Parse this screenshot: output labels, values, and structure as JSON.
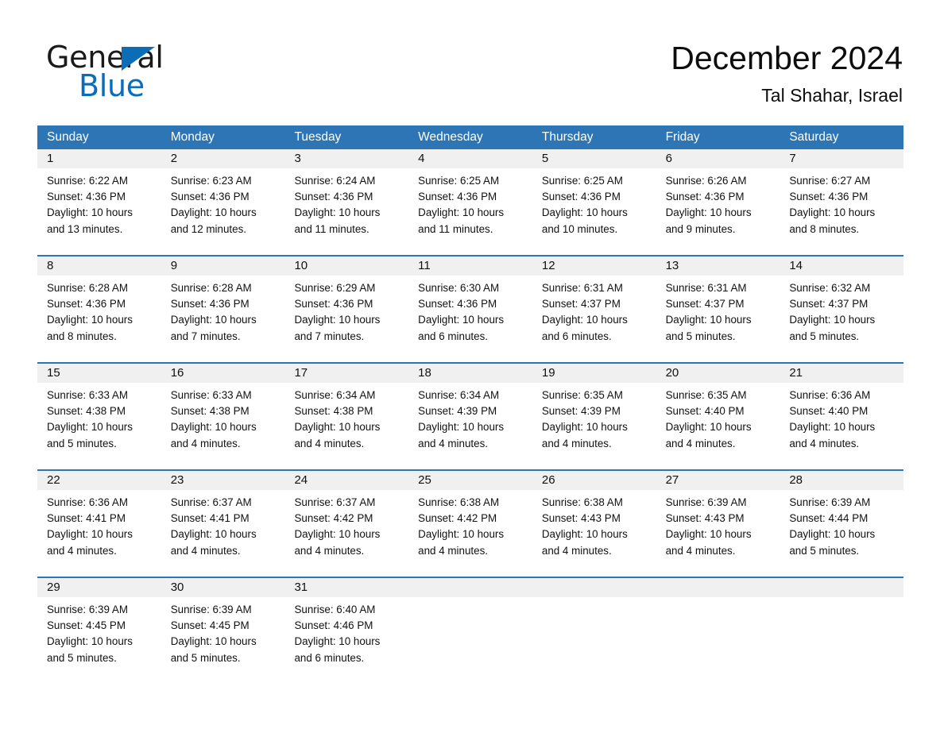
{
  "logo": {
    "part1": "General",
    "part2": "Blue",
    "triangle_color": "#0b6cb7"
  },
  "header": {
    "title": "December 2024",
    "subtitle": "Tal Shahar, Israel"
  },
  "theme": {
    "header_blue": "#2e75b6",
    "day_band_gray": "#f0f0f0",
    "text": "#111111"
  },
  "weekday_headers": [
    "Sunday",
    "Monday",
    "Tuesday",
    "Wednesday",
    "Thursday",
    "Friday",
    "Saturday"
  ],
  "weeks": [
    {
      "days": [
        {
          "date": "1",
          "sunrise": "Sunrise: 6:22 AM",
          "sunset": "Sunset: 4:36 PM",
          "daylight1": "Daylight: 10 hours",
          "daylight2": "and 13 minutes."
        },
        {
          "date": "2",
          "sunrise": "Sunrise: 6:23 AM",
          "sunset": "Sunset: 4:36 PM",
          "daylight1": "Daylight: 10 hours",
          "daylight2": "and 12 minutes."
        },
        {
          "date": "3",
          "sunrise": "Sunrise: 6:24 AM",
          "sunset": "Sunset: 4:36 PM",
          "daylight1": "Daylight: 10 hours",
          "daylight2": "and 11 minutes."
        },
        {
          "date": "4",
          "sunrise": "Sunrise: 6:25 AM",
          "sunset": "Sunset: 4:36 PM",
          "daylight1": "Daylight: 10 hours",
          "daylight2": "and 11 minutes."
        },
        {
          "date": "5",
          "sunrise": "Sunrise: 6:25 AM",
          "sunset": "Sunset: 4:36 PM",
          "daylight1": "Daylight: 10 hours",
          "daylight2": "and 10 minutes."
        },
        {
          "date": "6",
          "sunrise": "Sunrise: 6:26 AM",
          "sunset": "Sunset: 4:36 PM",
          "daylight1": "Daylight: 10 hours",
          "daylight2": "and 9 minutes."
        },
        {
          "date": "7",
          "sunrise": "Sunrise: 6:27 AM",
          "sunset": "Sunset: 4:36 PM",
          "daylight1": "Daylight: 10 hours",
          "daylight2": "and 8 minutes."
        }
      ]
    },
    {
      "days": [
        {
          "date": "8",
          "sunrise": "Sunrise: 6:28 AM",
          "sunset": "Sunset: 4:36 PM",
          "daylight1": "Daylight: 10 hours",
          "daylight2": "and 8 minutes."
        },
        {
          "date": "9",
          "sunrise": "Sunrise: 6:28 AM",
          "sunset": "Sunset: 4:36 PM",
          "daylight1": "Daylight: 10 hours",
          "daylight2": "and 7 minutes."
        },
        {
          "date": "10",
          "sunrise": "Sunrise: 6:29 AM",
          "sunset": "Sunset: 4:36 PM",
          "daylight1": "Daylight: 10 hours",
          "daylight2": "and 7 minutes."
        },
        {
          "date": "11",
          "sunrise": "Sunrise: 6:30 AM",
          "sunset": "Sunset: 4:36 PM",
          "daylight1": "Daylight: 10 hours",
          "daylight2": "and 6 minutes."
        },
        {
          "date": "12",
          "sunrise": "Sunrise: 6:31 AM",
          "sunset": "Sunset: 4:37 PM",
          "daylight1": "Daylight: 10 hours",
          "daylight2": "and 6 minutes."
        },
        {
          "date": "13",
          "sunrise": "Sunrise: 6:31 AM",
          "sunset": "Sunset: 4:37 PM",
          "daylight1": "Daylight: 10 hours",
          "daylight2": "and 5 minutes."
        },
        {
          "date": "14",
          "sunrise": "Sunrise: 6:32 AM",
          "sunset": "Sunset: 4:37 PM",
          "daylight1": "Daylight: 10 hours",
          "daylight2": "and 5 minutes."
        }
      ]
    },
    {
      "days": [
        {
          "date": "15",
          "sunrise": "Sunrise: 6:33 AM",
          "sunset": "Sunset: 4:38 PM",
          "daylight1": "Daylight: 10 hours",
          "daylight2": "and 5 minutes."
        },
        {
          "date": "16",
          "sunrise": "Sunrise: 6:33 AM",
          "sunset": "Sunset: 4:38 PM",
          "daylight1": "Daylight: 10 hours",
          "daylight2": "and 4 minutes."
        },
        {
          "date": "17",
          "sunrise": "Sunrise: 6:34 AM",
          "sunset": "Sunset: 4:38 PM",
          "daylight1": "Daylight: 10 hours",
          "daylight2": "and 4 minutes."
        },
        {
          "date": "18",
          "sunrise": "Sunrise: 6:34 AM",
          "sunset": "Sunset: 4:39 PM",
          "daylight1": "Daylight: 10 hours",
          "daylight2": "and 4 minutes."
        },
        {
          "date": "19",
          "sunrise": "Sunrise: 6:35 AM",
          "sunset": "Sunset: 4:39 PM",
          "daylight1": "Daylight: 10 hours",
          "daylight2": "and 4 minutes."
        },
        {
          "date": "20",
          "sunrise": "Sunrise: 6:35 AM",
          "sunset": "Sunset: 4:40 PM",
          "daylight1": "Daylight: 10 hours",
          "daylight2": "and 4 minutes."
        },
        {
          "date": "21",
          "sunrise": "Sunrise: 6:36 AM",
          "sunset": "Sunset: 4:40 PM",
          "daylight1": "Daylight: 10 hours",
          "daylight2": "and 4 minutes."
        }
      ]
    },
    {
      "days": [
        {
          "date": "22",
          "sunrise": "Sunrise: 6:36 AM",
          "sunset": "Sunset: 4:41 PM",
          "daylight1": "Daylight: 10 hours",
          "daylight2": "and 4 minutes."
        },
        {
          "date": "23",
          "sunrise": "Sunrise: 6:37 AM",
          "sunset": "Sunset: 4:41 PM",
          "daylight1": "Daylight: 10 hours",
          "daylight2": "and 4 minutes."
        },
        {
          "date": "24",
          "sunrise": "Sunrise: 6:37 AM",
          "sunset": "Sunset: 4:42 PM",
          "daylight1": "Daylight: 10 hours",
          "daylight2": "and 4 minutes."
        },
        {
          "date": "25",
          "sunrise": "Sunrise: 6:38 AM",
          "sunset": "Sunset: 4:42 PM",
          "daylight1": "Daylight: 10 hours",
          "daylight2": "and 4 minutes."
        },
        {
          "date": "26",
          "sunrise": "Sunrise: 6:38 AM",
          "sunset": "Sunset: 4:43 PM",
          "daylight1": "Daylight: 10 hours",
          "daylight2": "and 4 minutes."
        },
        {
          "date": "27",
          "sunrise": "Sunrise: 6:39 AM",
          "sunset": "Sunset: 4:43 PM",
          "daylight1": "Daylight: 10 hours",
          "daylight2": "and 4 minutes."
        },
        {
          "date": "28",
          "sunrise": "Sunrise: 6:39 AM",
          "sunset": "Sunset: 4:44 PM",
          "daylight1": "Daylight: 10 hours",
          "daylight2": "and 5 minutes."
        }
      ]
    },
    {
      "days": [
        {
          "date": "29",
          "sunrise": "Sunrise: 6:39 AM",
          "sunset": "Sunset: 4:45 PM",
          "daylight1": "Daylight: 10 hours",
          "daylight2": "and 5 minutes."
        },
        {
          "date": "30",
          "sunrise": "Sunrise: 6:39 AM",
          "sunset": "Sunset: 4:45 PM",
          "daylight1": "Daylight: 10 hours",
          "daylight2": "and 5 minutes."
        },
        {
          "date": "31",
          "sunrise": "Sunrise: 6:40 AM",
          "sunset": "Sunset: 4:46 PM",
          "daylight1": "Daylight: 10 hours",
          "daylight2": "and 6 minutes."
        },
        {
          "date": "",
          "sunrise": "",
          "sunset": "",
          "daylight1": "",
          "daylight2": ""
        },
        {
          "date": "",
          "sunrise": "",
          "sunset": "",
          "daylight1": "",
          "daylight2": ""
        },
        {
          "date": "",
          "sunrise": "",
          "sunset": "",
          "daylight1": "",
          "daylight2": ""
        },
        {
          "date": "",
          "sunrise": "",
          "sunset": "",
          "daylight1": "",
          "daylight2": ""
        }
      ]
    }
  ]
}
